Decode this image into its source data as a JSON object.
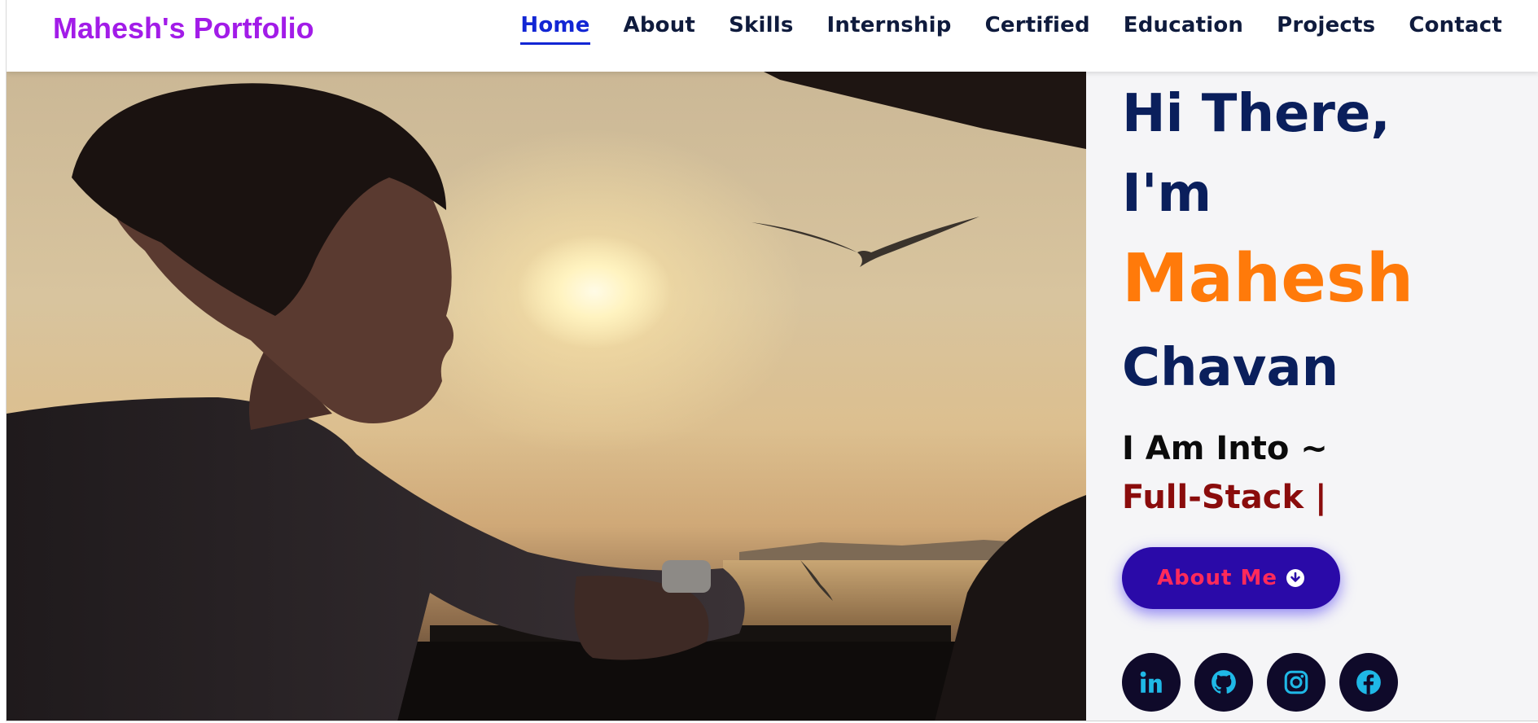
{
  "brand": "Mahesh's Portfolio",
  "nav": {
    "items": [
      "Home",
      "About",
      "Skills",
      "Internship",
      "Certified",
      "Education",
      "Projects",
      "Contact"
    ],
    "active": "Home"
  },
  "hero": {
    "greeting_line1": "Hi There,",
    "greeting_line2": "I'm",
    "first_name": "Mahesh",
    "last_name": "Chavan",
    "into_label": "I Am Into ~",
    "typed_text": "Full-Stack |",
    "about_button": "About Me",
    "about_icon": "arrow-down-circle-icon",
    "photo_alt": "silhouette-at-sunset-photo"
  },
  "socials": [
    {
      "name": "linkedin",
      "icon": "linkedin-icon"
    },
    {
      "name": "github",
      "icon": "github-icon"
    },
    {
      "name": "instagram",
      "icon": "instagram-icon"
    },
    {
      "name": "facebook",
      "icon": "facebook-icon"
    }
  ],
  "colors": {
    "brand": "#a21ce8",
    "nav_active": "#1226d4",
    "heading_navy": "#0a1f5c",
    "name_orange": "#ff7a0a",
    "typed_red": "#8a0c0c",
    "button_bg": "#2a0aa8",
    "button_text": "#ff2a5a",
    "social_bg": "#0f0a2a",
    "social_icon": "#1fb8e6"
  }
}
